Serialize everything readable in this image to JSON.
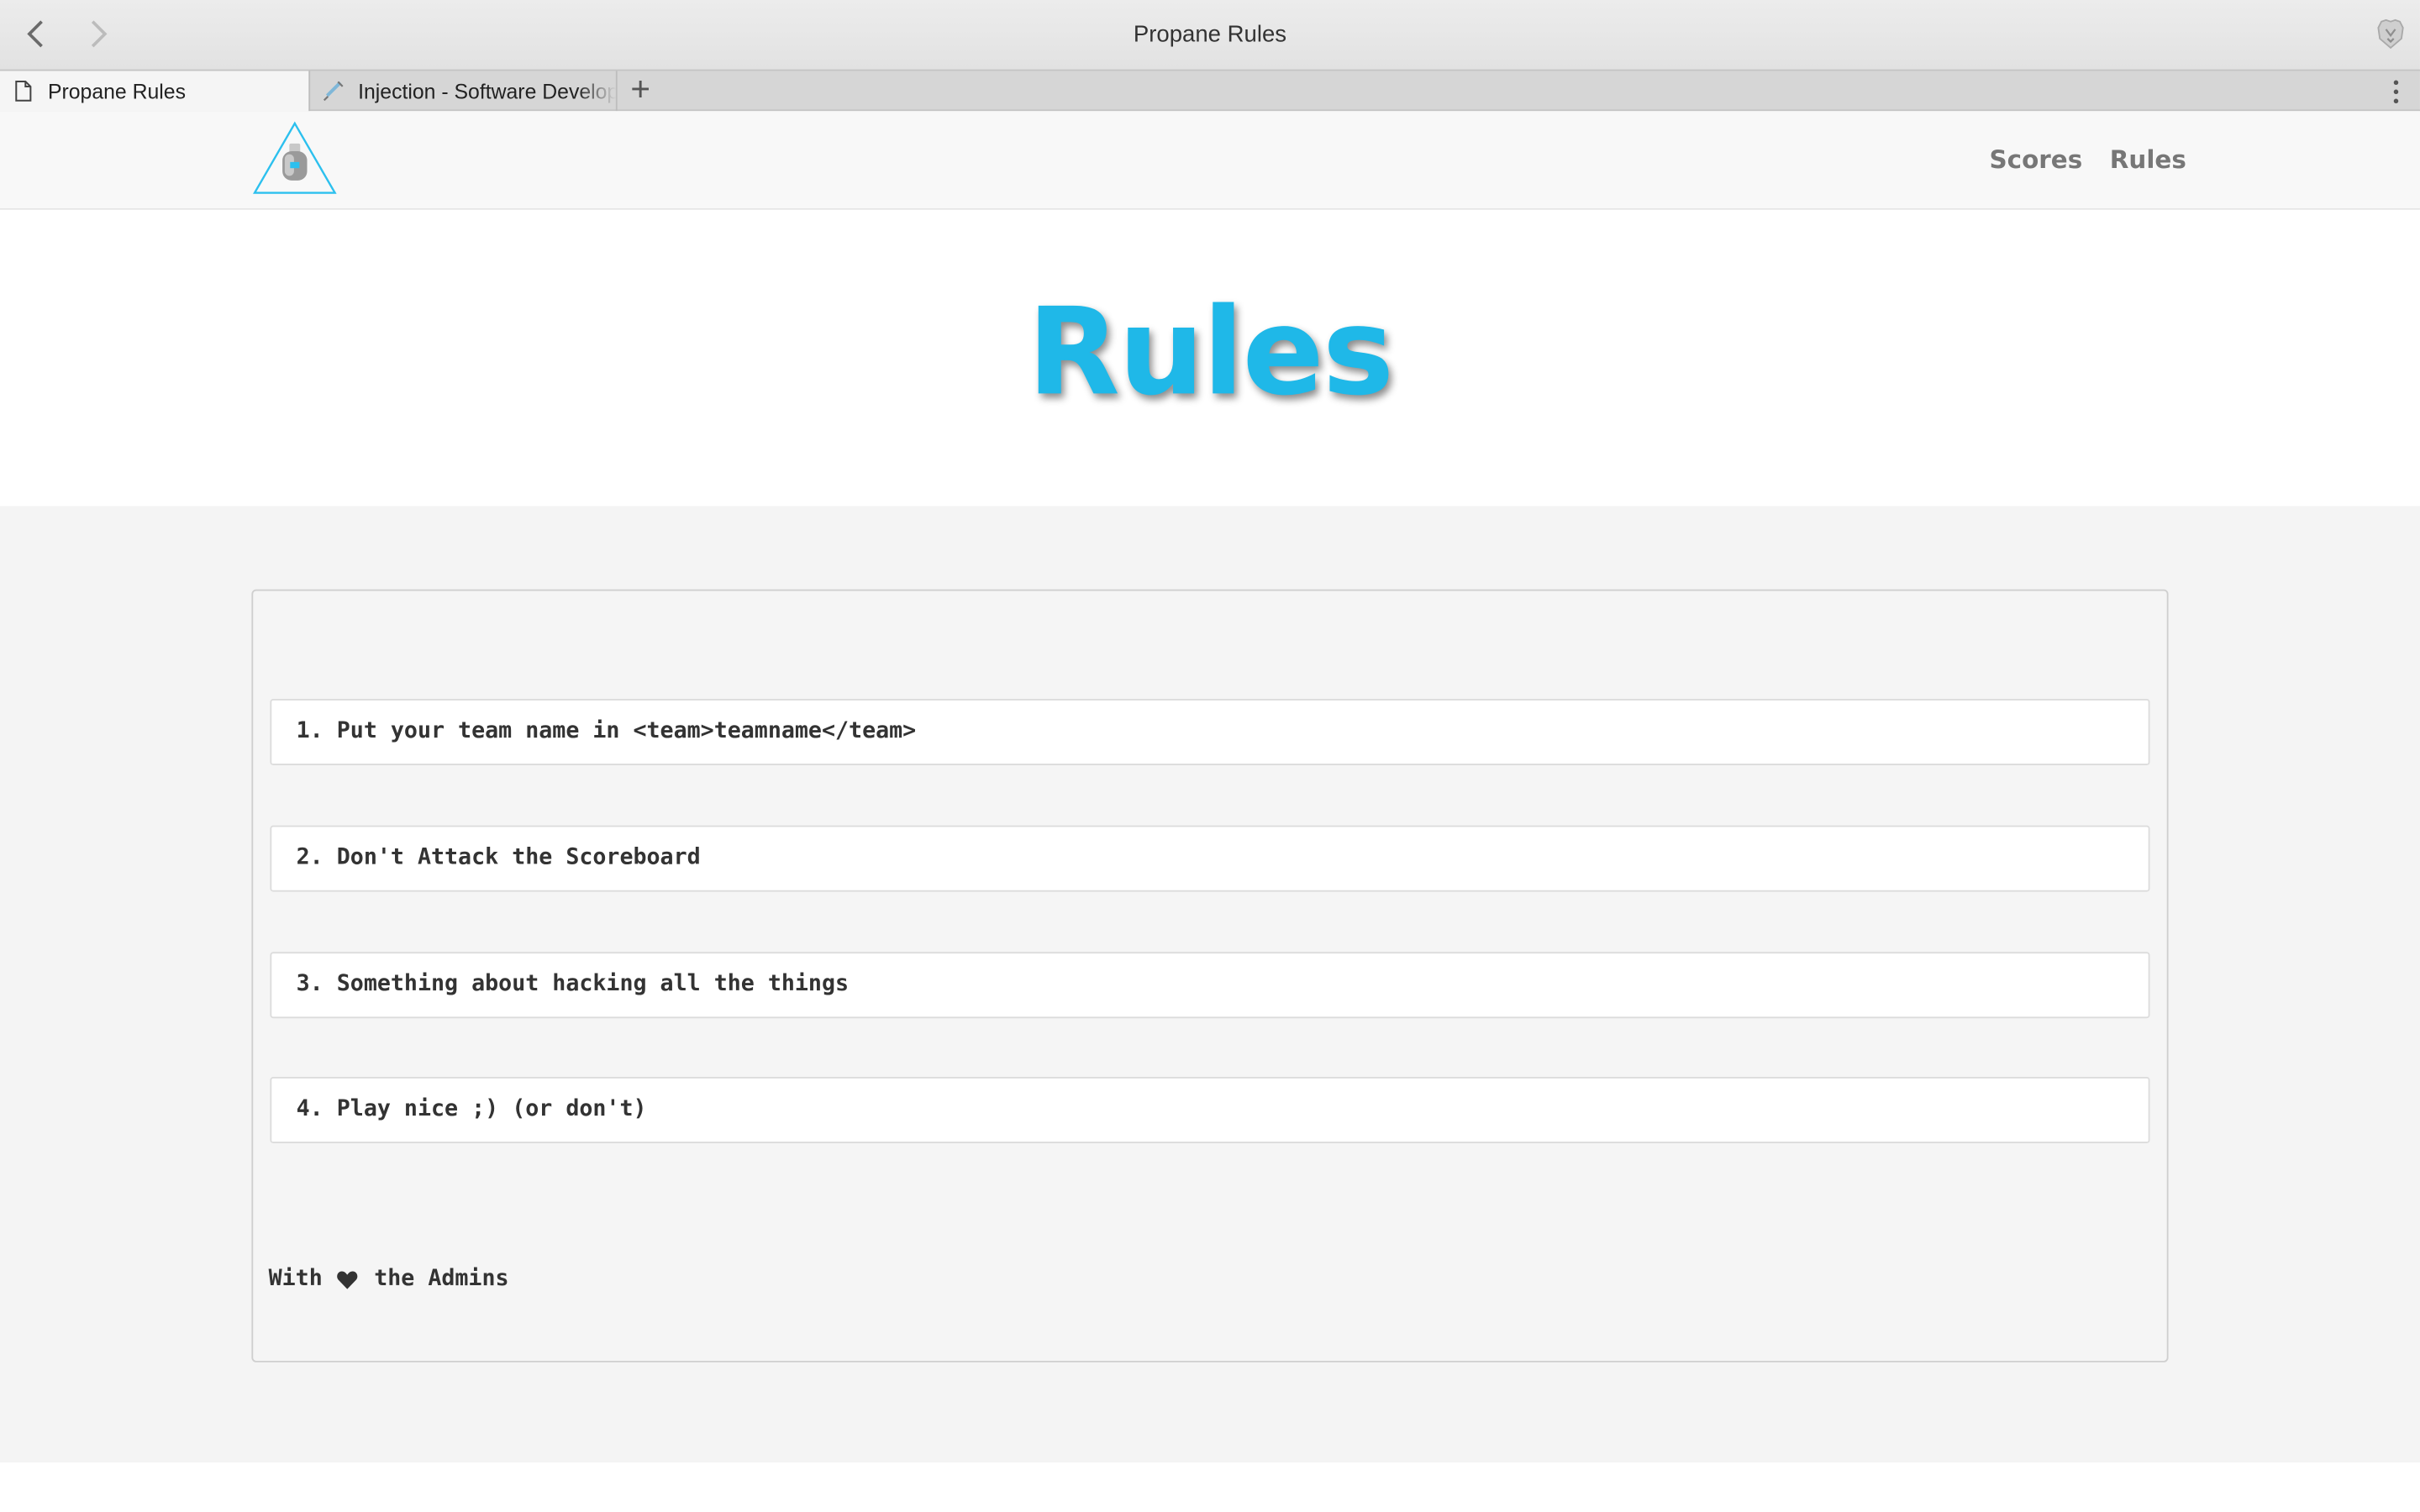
{
  "browser": {
    "window_title": "Propane Rules",
    "tabs": [
      {
        "label": "Propane Rules",
        "icon": "page-icon",
        "active": true
      },
      {
        "label": "Injection - Software Development",
        "icon": "syringe-icon",
        "active": false
      }
    ],
    "icons": {
      "back": "chevron-left-icon",
      "forward": "chevron-right-icon",
      "brave": "brave-lion-icon",
      "new_tab": "plus-icon",
      "menu": "vertical-dots-icon"
    }
  },
  "site": {
    "logo": "propane-tank-logo",
    "nav": [
      {
        "label": "Scores"
      },
      {
        "label": "Rules"
      }
    ],
    "hero_title": "Rules",
    "rules": [
      "1. Put your team name in <team>teamname</team>",
      "2. Don't Attack the Scoreboard",
      "3. Something about hacking all the things",
      "4. Play nice ;) (or don't)"
    ],
    "signoff": {
      "before": "With ",
      "icon": "heart-icon",
      "after": " the Admins"
    }
  },
  "colors": {
    "accent": "#1fb8e8",
    "nav_text": "#777777",
    "content_bg": "#f4f4f4"
  }
}
